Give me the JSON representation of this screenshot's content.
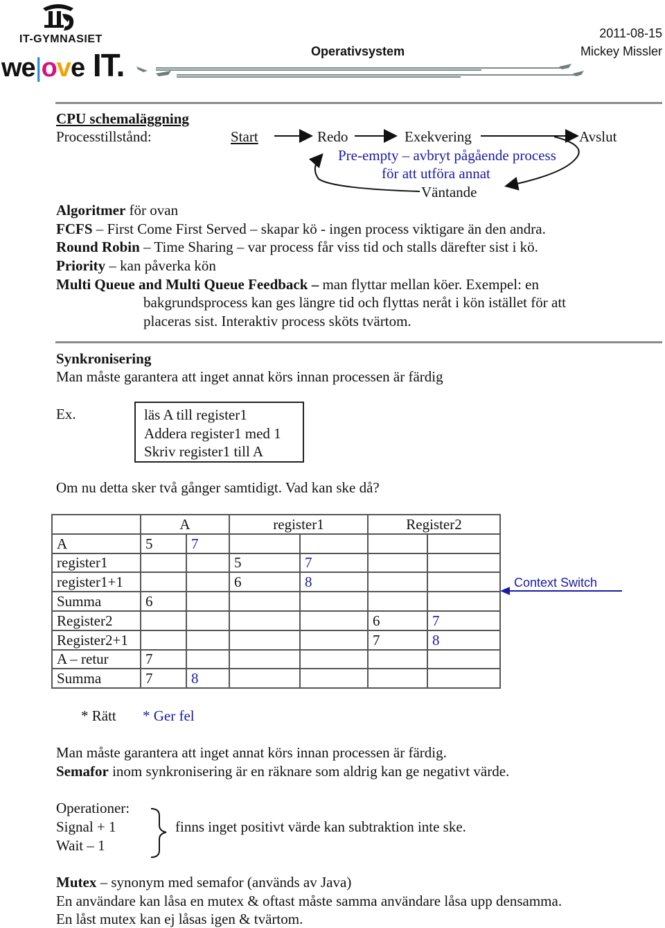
{
  "header": {
    "logo": {
      "school_name": "IT-GYMNASIET",
      "slogan_parts": [
        "we",
        "|",
        "o",
        "v",
        "e",
        " IT."
      ],
      "colors": {
        "bar": "#1e88d4",
        "o": "#d4147a",
        "v": "#f0a400"
      }
    },
    "title": "Operativsystem",
    "date": "2011-08-15",
    "author": "Mickey Missler"
  },
  "cpu_section": {
    "heading": "CPU schemaläggning",
    "process_states_label": "Processtillstånd:",
    "diagram": {
      "states": {
        "start": "Start",
        "ready": "Redo",
        "running": "Exekvering",
        "terminated": "Avslut",
        "waiting": "Väntande"
      },
      "preempt_note_line1": "Pre-empty – avbryt pågående process",
      "preempt_note_line2": "för att utföra annat"
    },
    "algorithms": {
      "intro_bold": "Algoritmer",
      "intro_rest": " för ovan",
      "items": [
        {
          "name": "FCFS",
          "text": " – First Come First Served – skapar kö -  ingen process viktigare än den andra."
        },
        {
          "name": "Round Robin",
          "text": " – Time Sharing – var process får viss tid och stalls därefter sist i kö."
        },
        {
          "name": "Priority",
          "text": " – kan påverka kön"
        },
        {
          "name": "Multi Queue and Multi Queue Feedback",
          "dash": " –",
          "text": " man flyttar mellan köer. Exempel: en"
        }
      ],
      "mq_continuation_1": "bakgrundsprocess kan ges längre tid och flyttas neråt i kön istället för att",
      "mq_continuation_2": "placeras sist. Interaktiv process sköts tvärtom."
    }
  },
  "sync_section": {
    "heading": "Synkronisering",
    "intro": "Man måste garantera att inget annat körs innan processen är färdig",
    "example_label": "Ex.",
    "code_lines": [
      "läs A till register1",
      "Addera register1 med 1",
      "Skriv register1 till A"
    ],
    "question": "Om nu detta sker två gånger samtidigt. Vad kan ske då?",
    "table": {
      "headers": [
        "",
        "A",
        "register1",
        "Register2"
      ],
      "rows": [
        {
          "label": "A",
          "cells": [
            "5",
            "7",
            "",
            "",
            "",
            ""
          ]
        },
        {
          "label": "register1",
          "cells": [
            "",
            "",
            "5",
            "7",
            "",
            ""
          ]
        },
        {
          "label": "register1+1",
          "cells": [
            "",
            "",
            "6",
            "8",
            "",
            ""
          ]
        },
        {
          "label": "Summa",
          "cells": [
            "6",
            "",
            "",
            "",
            "",
            ""
          ]
        },
        {
          "label": "Register2",
          "cells": [
            "",
            "",
            "",
            "",
            "6",
            "7"
          ]
        },
        {
          "label": "Register2+1",
          "cells": [
            "",
            "",
            "",
            "",
            "7",
            "8"
          ]
        },
        {
          "label": "A – retur",
          "cells": [
            "7",
            "",
            "",
            "",
            "",
            ""
          ]
        },
        {
          "label": "Summa",
          "cells": [
            "7",
            "8",
            "",
            "",
            "",
            ""
          ]
        }
      ]
    },
    "context_switch_label": "Context Switch",
    "legend": {
      "correct": "*   Rätt",
      "error": "*  Ger fel"
    },
    "guarantee": "Man måste garantera att inget annat körs innan processen är färdig.",
    "semaphore_bold": "Semafor",
    "semaphore_rest": " inom synkronisering är en räknare som aldrig kan ge negativt värde.",
    "operations_label": "Operationer:",
    "operations": [
      "Signal + 1",
      "Wait – 1"
    ],
    "operations_note": "finns inget positivt värde kan subtraktion inte ske.",
    "mutex_bold": "Mutex",
    "mutex_rest": " – synonym med semafor (används av Java)",
    "mutex_line2": "En användare kan låsa en mutex & oftast måste samma användare låsa upp densamma.",
    "mutex_line3": "En låst mutex kan ej låsas igen & tvärtom."
  },
  "colors": {
    "accent_blue": "#1a1aa6",
    "rule_gray": "#8a8a8a",
    "header_line": "#7a8a88"
  }
}
